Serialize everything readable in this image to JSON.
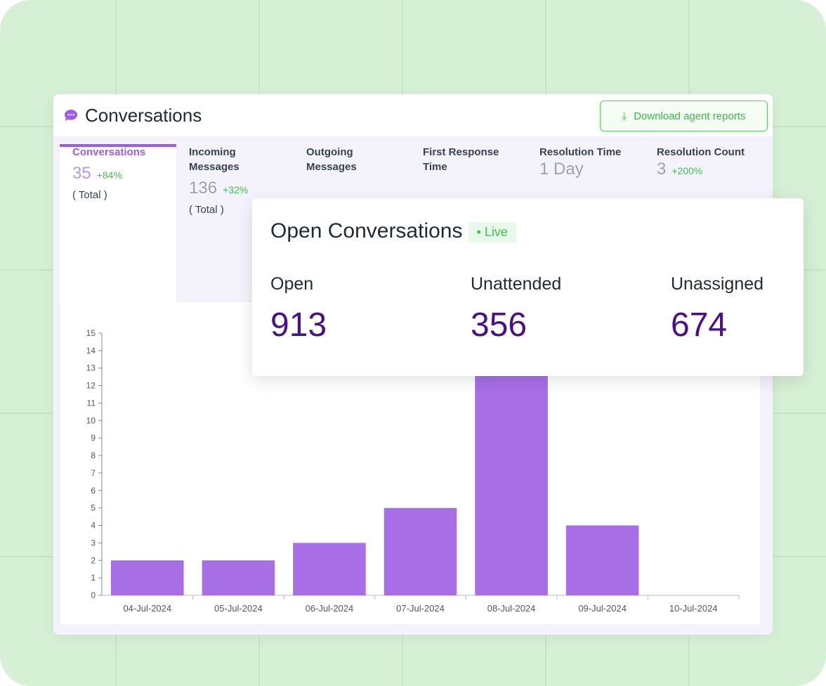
{
  "header": {
    "title": "Conversations",
    "download_label": "Download agent reports"
  },
  "tabs": [
    {
      "label": "Conversations",
      "value": "35",
      "change": "+84%",
      "sub": "( Total )",
      "active": true
    },
    {
      "label": "Incoming Messages",
      "value": "136",
      "change": "+32%",
      "sub": "( Total )"
    },
    {
      "label": "Outgoing Messages"
    },
    {
      "label": "First Response Time"
    },
    {
      "label": "Resolution Time",
      "value": "1 Day"
    },
    {
      "label": "Resolution Count",
      "value": "3",
      "change": "+200%"
    }
  ],
  "open_conversations": {
    "title": "Open Conversations",
    "badge": "Live",
    "stats": [
      {
        "label": "Open",
        "value": "913"
      },
      {
        "label": "Unattended",
        "value": "356"
      },
      {
        "label": "Unassigned",
        "value": "674"
      }
    ]
  },
  "colors": {
    "accent": "#9b5de5",
    "bar": "#a76ee6",
    "positive": "#3fc24e",
    "stat_value": "#4b0f8a"
  },
  "chart_data": {
    "type": "bar",
    "categories": [
      "04-Jul-2024",
      "05-Jul-2024",
      "06-Jul-2024",
      "07-Jul-2024",
      "08-Jul-2024",
      "09-Jul-2024",
      "10-Jul-2024"
    ],
    "values": [
      2,
      2,
      3,
      5,
      14,
      4,
      0
    ],
    "ylim": [
      0,
      15
    ],
    "yticks": [
      0,
      1,
      2,
      3,
      4,
      5,
      6,
      7,
      8,
      9,
      10,
      11,
      12,
      13,
      14,
      15
    ],
    "grid": false
  }
}
